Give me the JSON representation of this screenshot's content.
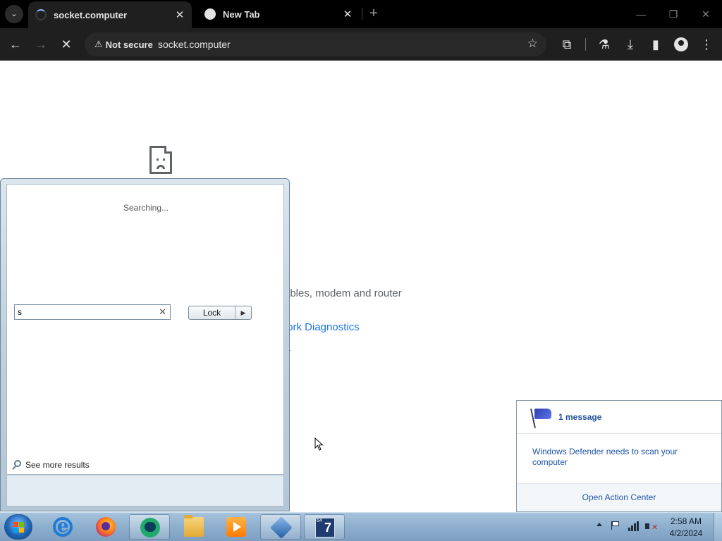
{
  "browser": {
    "tabs": [
      {
        "title": "socket.computer",
        "active": true
      },
      {
        "title": "New Tab",
        "active": false
      }
    ],
    "tab_close_glyph": "✕",
    "new_tab_glyph": "+",
    "window_controls": {
      "minimize": "—",
      "restore": "❐",
      "close": "✕"
    },
    "toolbar": {
      "back_icon": "←",
      "forward_icon": "→",
      "stop_icon": "✕",
      "security_chip": "Not secure",
      "warning_glyph": "⚠",
      "url": "socket.computer",
      "bookmark_icon": "☆",
      "extensions_icon": "⧉",
      "labs_icon": "⚗",
      "download_icon": "⤓",
      "sidepanel_icon": "▮",
      "menu_icon": "⋮"
    }
  },
  "page": {
    "error_line_fragment": "ables, modem and router",
    "error_link_fragment": "/ork Diagnostics"
  },
  "start_menu": {
    "status": "Searching...",
    "see_more": "See more results",
    "search_value": "s",
    "clear_glyph": "✕",
    "lock_label": "Lock",
    "lock_arrow": "▶"
  },
  "notification": {
    "count": "1 message",
    "message": "Windows Defender needs to scan your computer",
    "action": "Open Action Center"
  },
  "taskbar": {
    "clock_time": "2:58 AM",
    "clock_date": "4/2/2024",
    "w7_badge_top": "64",
    "w7_badge_num": "7"
  }
}
